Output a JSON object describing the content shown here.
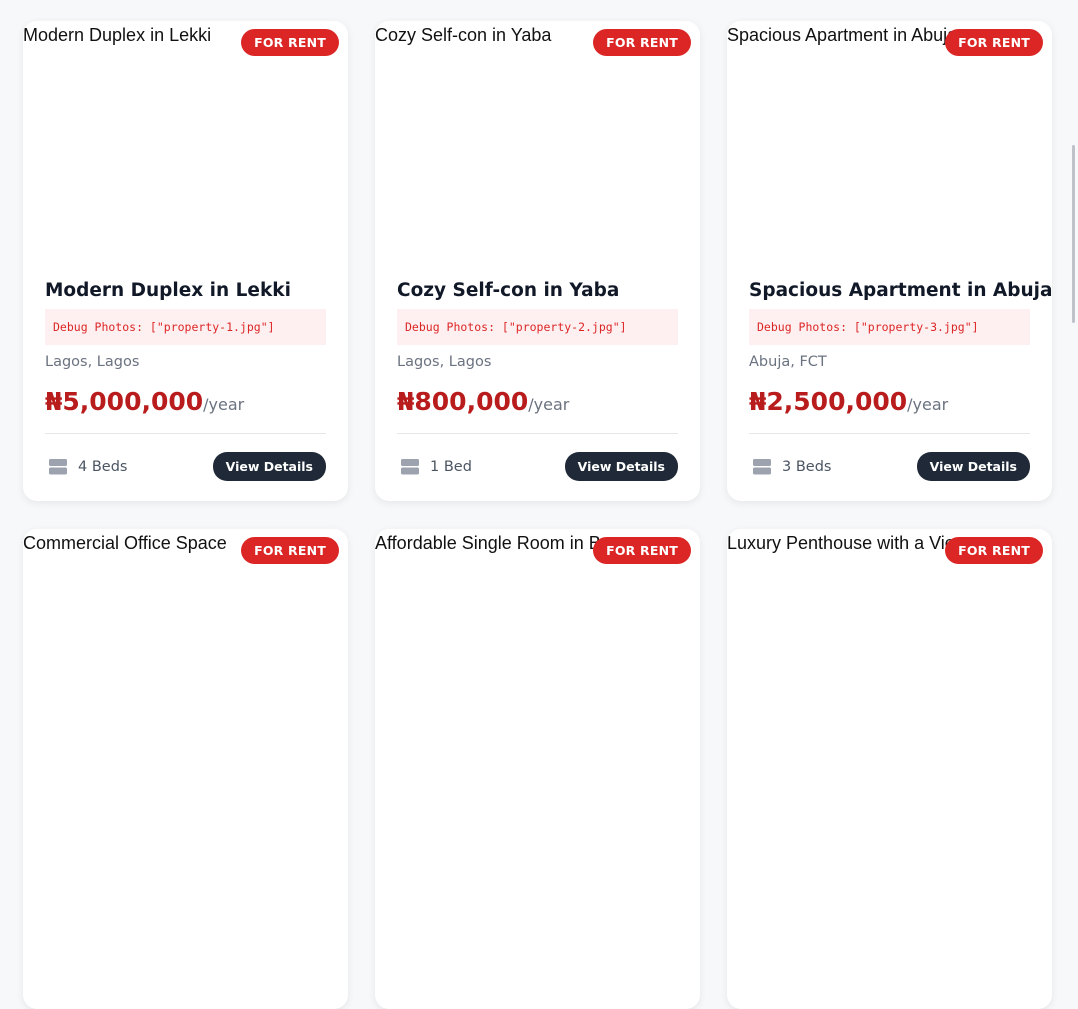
{
  "listings": [
    {
      "image_alt": "Modern Duplex in Lekki",
      "badge": "FOR RENT",
      "title": "Modern Duplex in Lekki",
      "debug": "Debug Photos: [\"property-1.jpg\"]",
      "location": "Lagos, Lagos",
      "price": "₦5,000,000",
      "period": "/year",
      "beds": "4 Beds",
      "button": "View Details"
    },
    {
      "image_alt": "Cozy Self-con in Yaba",
      "badge": "FOR RENT",
      "title": "Cozy Self-con in Yaba",
      "debug": "Debug Photos: [\"property-2.jpg\"]",
      "location": "Lagos, Lagos",
      "price": "₦800,000",
      "period": "/year",
      "beds": "1 Bed",
      "button": "View Details"
    },
    {
      "image_alt": "Spacious Apartment in Abuja",
      "badge": "FOR RENT",
      "title": "Spacious Apartment in Abuja",
      "debug": "Debug Photos: [\"property-3.jpg\"]",
      "location": "Abuja, FCT",
      "price": "₦2,500,000",
      "period": "/year",
      "beds": "3 Beds",
      "button": "View Details"
    },
    {
      "image_alt": "Commercial Office Space",
      "badge": "FOR RENT"
    },
    {
      "image_alt": "Affordable Single Room in Be",
      "badge": "FOR RENT"
    },
    {
      "image_alt": "Luxury Penthouse with a View",
      "badge": "FOR RENT"
    }
  ],
  "icons": {
    "bed": "bed-icon"
  },
  "colors": {
    "badge": "#dc2626",
    "price": "#b91c1c",
    "button": "#1f2937",
    "debug_bg": "#fef0f0"
  }
}
